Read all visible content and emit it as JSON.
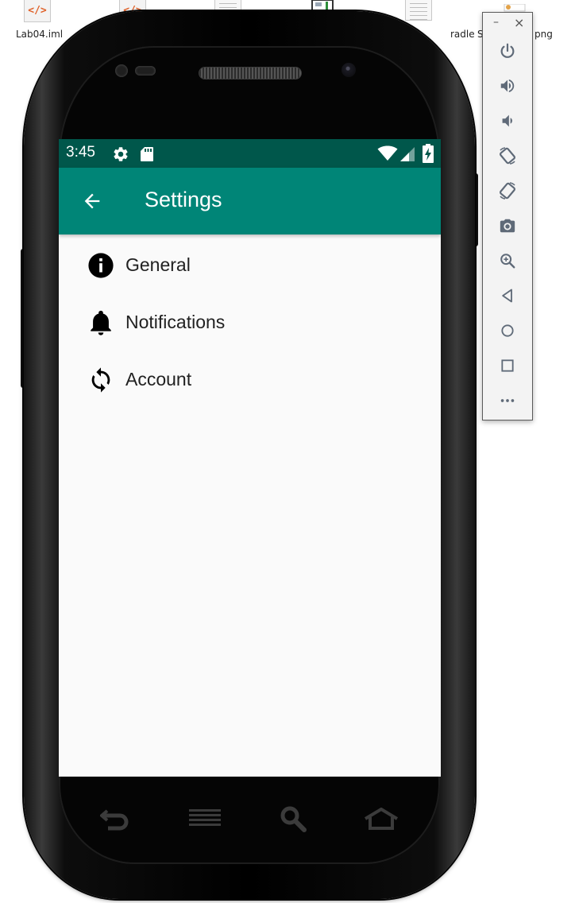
{
  "desktop": {
    "files": [
      {
        "label": "Lab04.iml",
        "icon": "code-file-icon"
      },
      {
        "label": "",
        "icon": "code-file-icon"
      },
      {
        "label": "",
        "icon": "document-icon"
      },
      {
        "label": "",
        "icon": "image-file-icon"
      },
      {
        "label": "radle",
        "icon": "document-icon"
      },
      {
        "label": "S",
        "icon": "image-file-icon"
      },
      {
        "label": "png",
        "icon": ""
      }
    ]
  },
  "status_bar": {
    "time": "3:45",
    "icons": [
      "gear-icon",
      "sd-card-icon",
      "wifi-icon",
      "signal-icon",
      "battery-charging-icon"
    ],
    "color": "#00574b"
  },
  "app_bar": {
    "title": "Settings",
    "back_icon": "arrow-back-icon",
    "color": "#008577"
  },
  "preferences": [
    {
      "label": "General",
      "icon": "info-icon"
    },
    {
      "label": "Notifications",
      "icon": "bell-icon"
    },
    {
      "label": "Account",
      "icon": "sync-icon"
    }
  ],
  "hardware_keys": [
    "back-key-icon",
    "menu-key-icon",
    "search-key-icon",
    "home-key-icon"
  ],
  "emulator_toolbar": {
    "window_controls": {
      "minimize": "–",
      "close": "×"
    },
    "buttons": [
      "power-icon",
      "volume-up-icon",
      "volume-down-icon",
      "rotate-left-icon",
      "rotate-right-icon",
      "camera-icon",
      "zoom-icon",
      "back-triangle-icon",
      "home-circle-icon",
      "overview-square-icon",
      "more-icon"
    ]
  }
}
